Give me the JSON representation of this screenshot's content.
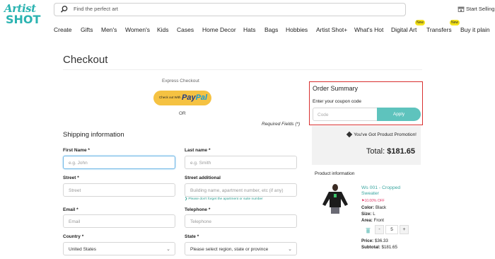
{
  "header": {
    "logo_line1": "Artist",
    "logo_line2": "SHOT",
    "search_placeholder": "Find the perfect art",
    "start_selling": "Start Selling",
    "nav": [
      "Create",
      "Gifts",
      "Men's",
      "Women's",
      "Kids",
      "Cases",
      "Home Decor",
      "Hats",
      "Bags",
      "Hobbies",
      "Artist Shot+",
      "What's Hot",
      "Digital Art",
      "Transfers",
      "Buy it plain"
    ],
    "new_badge": "New"
  },
  "checkout": {
    "title": "Checkout",
    "express_label": "Express Checkout",
    "paypal_small": "Check out With",
    "paypal_pay": "Pay",
    "paypal_pal": "Pal",
    "or": "OR",
    "required_note": "Required Fields (*)",
    "shipping_title": "Shipping information",
    "fields": {
      "first_name": {
        "label": "First Name *",
        "placeholder": "e.g. John"
      },
      "last_name": {
        "label": "Last name *",
        "placeholder": "e.g. Smith"
      },
      "street": {
        "label": "Street *",
        "placeholder": "Street"
      },
      "street_additional": {
        "label": "Street additional",
        "placeholder": "Building name, apartment number, etc (if any)"
      },
      "street_note": "Please don't forget the apartment or suite number",
      "email": {
        "label": "Email *",
        "placeholder": "Email"
      },
      "telephone": {
        "label": "Telephone *",
        "placeholder": "Telephone"
      },
      "country": {
        "label": "Country *",
        "value": "United States"
      },
      "state": {
        "label": "State *",
        "value": "Please select region, state or province"
      }
    }
  },
  "summary": {
    "title": "Order Summary",
    "coupon_label": "Enter your coupon code",
    "coupon_placeholder": "Code",
    "apply": "Apply",
    "promotion": "You've Got Product Promotion!",
    "total_label": "Total:",
    "total_value": "$181.65",
    "product_info_label": "Product information",
    "product": {
      "name": "Ws 001 - Cropped Sweater",
      "discount": "10.00% OFF",
      "color_label": "Color:",
      "color": "Black",
      "size_label": "Size:",
      "size": "L",
      "area_label": "Area:",
      "area": "Front",
      "qty_minus": "-",
      "qty": "5",
      "qty_plus": "+",
      "price_label": "Price:",
      "price": "$36.33",
      "subtotal_label": "Subtotal:",
      "subtotal": "$181.65"
    }
  },
  "colors": {
    "brand": "#2bb3b1",
    "apply": "#5ec3bd",
    "highlight_border": "#d93030",
    "paypal": "#f5c242",
    "discount": "#e23a6a"
  },
  "icons": [
    "search-icon",
    "store-icon",
    "tag-icon",
    "trash-icon",
    "chevron-down-icon"
  ]
}
